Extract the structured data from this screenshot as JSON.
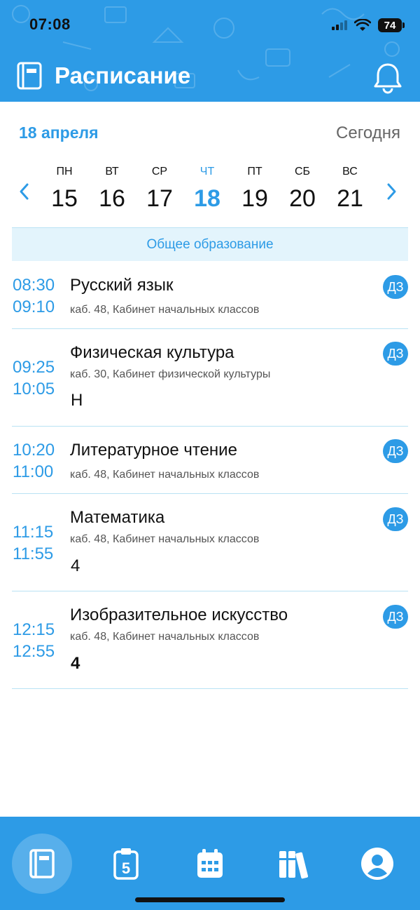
{
  "status_bar": {
    "time": "07:08",
    "battery": "74"
  },
  "header": {
    "title": "Расписание",
    "menu_icon": "book-icon",
    "notif_icon": "bell-icon"
  },
  "date_bar": {
    "date": "18 апреля",
    "today_label": "Сегодня"
  },
  "week": [
    {
      "dow": "ПН",
      "day": "15"
    },
    {
      "dow": "ВТ",
      "day": "16"
    },
    {
      "dow": "СР",
      "day": "17"
    },
    {
      "dow": "ЧТ",
      "day": "18",
      "active": true
    },
    {
      "dow": "ПТ",
      "day": "19"
    },
    {
      "dow": "СБ",
      "day": "20"
    },
    {
      "dow": "ВС",
      "day": "21"
    }
  ],
  "section": {
    "label": "Общее образование"
  },
  "lessons": [
    {
      "start": "08:30",
      "end": "09:10",
      "name": "Русский язык",
      "room": "каб. 48, Кабинет начальных классов",
      "mark": "",
      "hw": "ДЗ"
    },
    {
      "start": "09:25",
      "end": "10:05",
      "name": "Физическая культура",
      "room": "каб. 30, Кабинет физической культуры",
      "mark": "Н",
      "hw": "ДЗ"
    },
    {
      "start": "10:20",
      "end": "11:00",
      "name": "Литературное чтение",
      "room": "каб. 48, Кабинет начальных классов",
      "mark": "",
      "hw": "ДЗ"
    },
    {
      "start": "11:15",
      "end": "11:55",
      "name": "Математика",
      "room": "каб. 48, Кабинет начальных классов",
      "mark": "4",
      "hw": "ДЗ"
    },
    {
      "start": "12:15",
      "end": "12:55",
      "name": "Изобразительное искусство",
      "room": "каб. 48, Кабинет начальных классов",
      "mark": "4",
      "hw": "ДЗ"
    }
  ],
  "bottom_nav": [
    {
      "icon": "schedule-book-icon",
      "active": true
    },
    {
      "icon": "grades-clipboard-icon"
    },
    {
      "icon": "calendar-icon"
    },
    {
      "icon": "library-books-icon"
    },
    {
      "icon": "profile-icon"
    }
  ],
  "colors": {
    "accent": "#2d9be6",
    "banner": "#e3f4fc",
    "divider": "#b9e2f4"
  }
}
